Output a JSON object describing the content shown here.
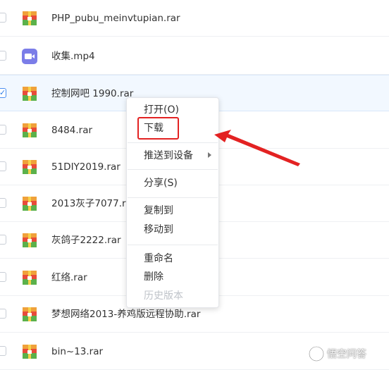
{
  "files": [
    {
      "name": "PHP_pubu_meinvtupian.rar",
      "type": "archive",
      "selected": false
    },
    {
      "name": "收集.mp4",
      "type": "video",
      "selected": false
    },
    {
      "name": "控制网吧 1990.rar",
      "type": "archive",
      "selected": true
    },
    {
      "name": "8484.rar",
      "type": "archive",
      "selected": false
    },
    {
      "name": "51DIY2019.rar",
      "type": "archive",
      "selected": false
    },
    {
      "name": "2013灰子7077.rar",
      "type": "archive",
      "selected": false
    },
    {
      "name": "灰鸽子2222.rar",
      "type": "archive",
      "selected": false
    },
    {
      "name": "红络.rar",
      "type": "archive",
      "selected": false
    },
    {
      "name": "梦想网络2013-养鸡版远程协助.rar",
      "type": "archive",
      "selected": false
    },
    {
      "name": "bin~13.rar",
      "type": "archive",
      "selected": false
    }
  ],
  "context_menu": {
    "open": "打开(O)",
    "download": "下载",
    "push_to_device": "推送到设备",
    "share": "分享(S)",
    "copy_to": "复制到",
    "move_to": "移动到",
    "rename": "重命名",
    "delete": "删除",
    "history": "历史版本"
  },
  "check_mark": "✓",
  "watermark": {
    "text": "悟空问答"
  },
  "colors": {
    "archive_icon": "#e84b3a",
    "video_icon": "#7b7de8",
    "highlight": "#e32222",
    "accent": "#2b7de9"
  },
  "icons": {
    "archive": "archive-icon",
    "video": "video-icon",
    "submenu": "chevron-right-icon",
    "arrow": "annotation-arrow"
  }
}
